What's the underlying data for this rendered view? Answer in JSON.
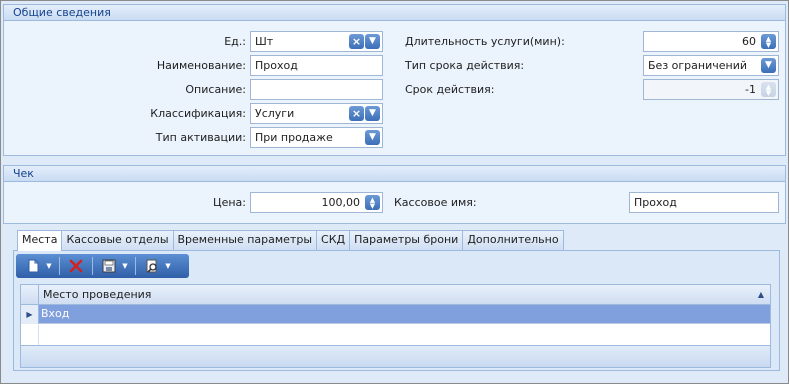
{
  "general": {
    "title": "Общие сведения",
    "unit_label": "Ед.:",
    "unit_value": "Шт",
    "name_label": "Наименование:",
    "name_value": "Проход",
    "desc_label": "Описание:",
    "desc_value": "",
    "class_label": "Классификация:",
    "class_value": "Услуги",
    "activation_label": "Тип активации:",
    "activation_value": "При продаже",
    "duration_label": "Длительность услуги(мин):",
    "duration_value": "60",
    "validity_type_label": "Тип срока действия:",
    "validity_type_value": "Без ограничений",
    "validity_label": "Срок действия:",
    "validity_value": "-1"
  },
  "check": {
    "title": "Чек",
    "price_label": "Цена:",
    "price_value": "100,00",
    "cash_name_label": "Кассовое имя:",
    "cash_name_value": "Проход"
  },
  "tabs": [
    {
      "label": "Места",
      "active": true
    },
    {
      "label": "Кассовые отделы",
      "active": false
    },
    {
      "label": "Временные параметры",
      "active": false
    },
    {
      "label": "СКД",
      "active": false
    },
    {
      "label": "Параметры брони",
      "active": false
    },
    {
      "label": "Дополнительно",
      "active": false
    }
  ],
  "toolbar": {
    "icons": [
      "new-document-icon",
      "delete-icon",
      "save-icon",
      "search-icon"
    ]
  },
  "grid": {
    "column": "Место проведения",
    "rows": [
      {
        "value": "Вход"
      }
    ]
  },
  "colors": {
    "accent": "#15428b",
    "selected_row": "#7f9fdd",
    "delete": "#d42020"
  }
}
